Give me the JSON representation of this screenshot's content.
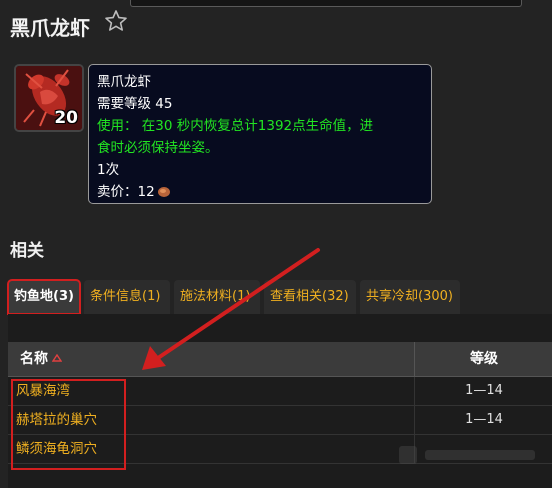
{
  "page": {
    "title": "黑爪龙虾"
  },
  "item": {
    "stack_count": "20",
    "tooltip": {
      "name": "黑爪龙虾",
      "required_level": "需要等级 45",
      "use_line1": "使用： 在30 秒内恢复总计1392点生命值，进",
      "use_line2": "食时必须保持坐姿。",
      "charges": "1次",
      "sell_price_label": "卖价：12"
    }
  },
  "related": {
    "title": "相关",
    "tabs": [
      {
        "label": "钓鱼地(3)"
      },
      {
        "label": "条件信息(1)"
      },
      {
        "label": "施法材料(1)"
      },
      {
        "label": "查看相关(32)"
      },
      {
        "label": "共享冷却(300)"
      }
    ],
    "table": {
      "columns": {
        "name": "名称",
        "level": "等级"
      },
      "rows": [
        {
          "name": "风暴海湾",
          "level": "1—14"
        },
        {
          "name": "赫塔拉的巢穴",
          "level": "1—14"
        },
        {
          "name": "鳞须海龟洞穴",
          "level": ""
        }
      ]
    }
  },
  "colors": {
    "background": "#232323",
    "link_gold": "#f0b020",
    "use_green": "#22e522",
    "highlight_red": "#d21f1f",
    "tooltip_bg": "#070b1f"
  },
  "icons": {
    "favorite": "star-outline-icon",
    "item": "lobster-icon",
    "currency": "copper-coin-icon",
    "sort": "triangle-up-icon"
  }
}
